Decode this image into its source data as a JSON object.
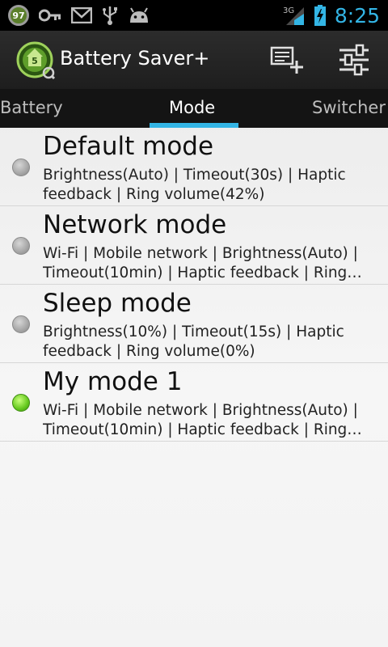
{
  "status_bar": {
    "badge_number": "97",
    "icons": [
      "key-icon",
      "gmail-icon",
      "usb-icon",
      "android-icon"
    ],
    "network_label": "3G",
    "time": "8:25",
    "accent_color": "#33b5e5"
  },
  "action_bar": {
    "title": "Battery Saver+",
    "buttons": [
      "add-mode-icon",
      "settings-sliders-icon"
    ]
  },
  "tabs": [
    {
      "label": "Battery"
    },
    {
      "label": "Mode",
      "selected": true
    },
    {
      "label": "Switcher"
    }
  ],
  "modes": [
    {
      "title": "Default mode",
      "description": "Brightness(Auto) | Timeout(30s) | Haptic feedback | Ring volume(42%)",
      "selected": false
    },
    {
      "title": "Network mode",
      "description": "Wi-Fi | Mobile network | Brightness(Auto) | Timeout(10min) | Haptic feedback | Ring…",
      "selected": false
    },
    {
      "title": "Sleep mode",
      "description": "Brightness(10%) | Timeout(15s) | Haptic feedback | Ring volume(0%)",
      "selected": false
    },
    {
      "title": "My mode 1",
      "description": "Wi-Fi | Mobile network | Brightness(Auto) | Timeout(10min) | Haptic feedback | Ring…",
      "selected": true
    }
  ]
}
